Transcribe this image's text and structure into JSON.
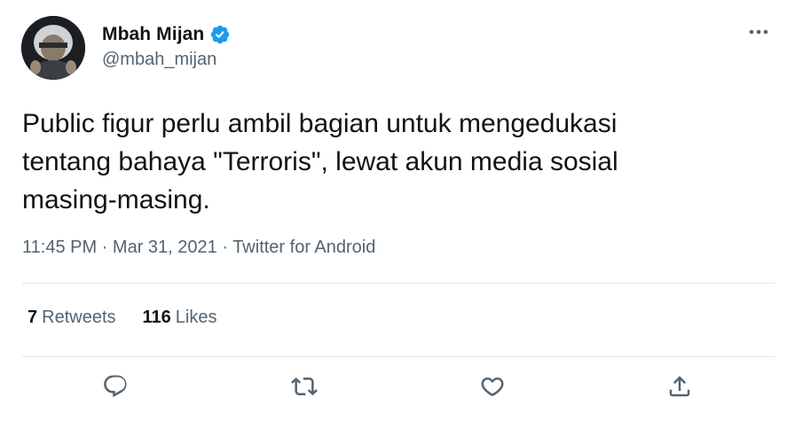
{
  "author": {
    "display_name": "Mbah Mijan",
    "handle": "@mbah_mijan",
    "verified": true
  },
  "tweet": {
    "text": "Public figur perlu ambil bagian untuk mengedukasi\ntentang bahaya \"Terroris\", lewat akun media sosial\nmasing-masing.",
    "time": "11:45 PM",
    "separator": " · ",
    "date": "Mar 31, 2021",
    "source": "Twitter for Android"
  },
  "stats": {
    "retweets_count": "7",
    "retweets_label": "Retweets",
    "likes_count": "116",
    "likes_label": "Likes"
  },
  "icons": {
    "more": "more-horizontal-icon",
    "reply": "reply-icon",
    "retweet": "retweet-icon",
    "like": "heart-icon",
    "share": "share-icon",
    "verified": "verified-badge-icon"
  },
  "colors": {
    "text": "#0f1419",
    "secondary": "#536471",
    "verified": "#1d9bf0",
    "divider": "#e1e8ed"
  }
}
